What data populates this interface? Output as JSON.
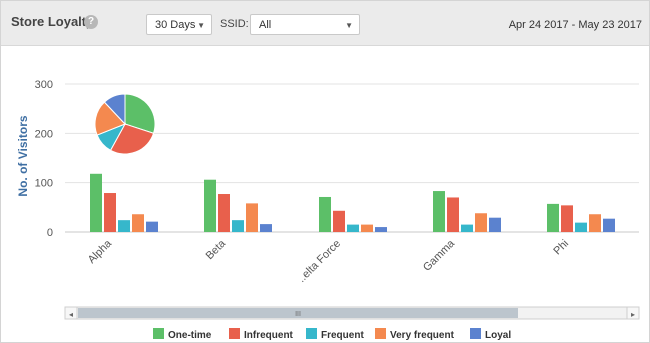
{
  "header": {
    "title": "Store Loyalty",
    "help_icon": "question-circle-icon",
    "range_select": {
      "value": "30 Days"
    },
    "ssid_label": "SSID:",
    "ssid_select": {
      "value": "All"
    },
    "date_range": "Apr 24 2017 - May 23 2017"
  },
  "scrollbar": {
    "thumb_glyph": "III",
    "left_arrow": "◂",
    "right_arrow": "▸"
  },
  "colors": {
    "One-time": "#5cbf68",
    "Infrequent": "#e8604c",
    "Frequent": "#36b7cb",
    "Very frequent": "#f4894f",
    "Loyal": "#5b82cf"
  },
  "chart_data": {
    "type": "bar",
    "ylabel": "No. of Visitors",
    "ylim": [
      0,
      300
    ],
    "yticks": [
      0,
      100,
      200,
      300
    ],
    "grid": true,
    "legend_position": "bottom",
    "categories": [
      "Alpha",
      "Beta",
      "..elta Force",
      "Gamma",
      "Phi"
    ],
    "series": [
      {
        "name": "One-time",
        "values": [
          118,
          106,
          71,
          83,
          57
        ]
      },
      {
        "name": "Infrequent",
        "values": [
          79,
          77,
          43,
          70,
          54
        ]
      },
      {
        "name": "Frequent",
        "values": [
          24,
          24,
          15,
          15,
          19
        ]
      },
      {
        "name": "Very frequent",
        "values": [
          36,
          58,
          15,
          38,
          36
        ]
      },
      {
        "name": "Loyal",
        "values": [
          21,
          16,
          10,
          29,
          27
        ]
      }
    ],
    "pie": {
      "labels": [
        "One-time",
        "Infrequent",
        "Frequent",
        "Very frequent",
        "Loyal"
      ],
      "values": [
        30,
        28,
        11,
        19,
        12
      ]
    }
  }
}
